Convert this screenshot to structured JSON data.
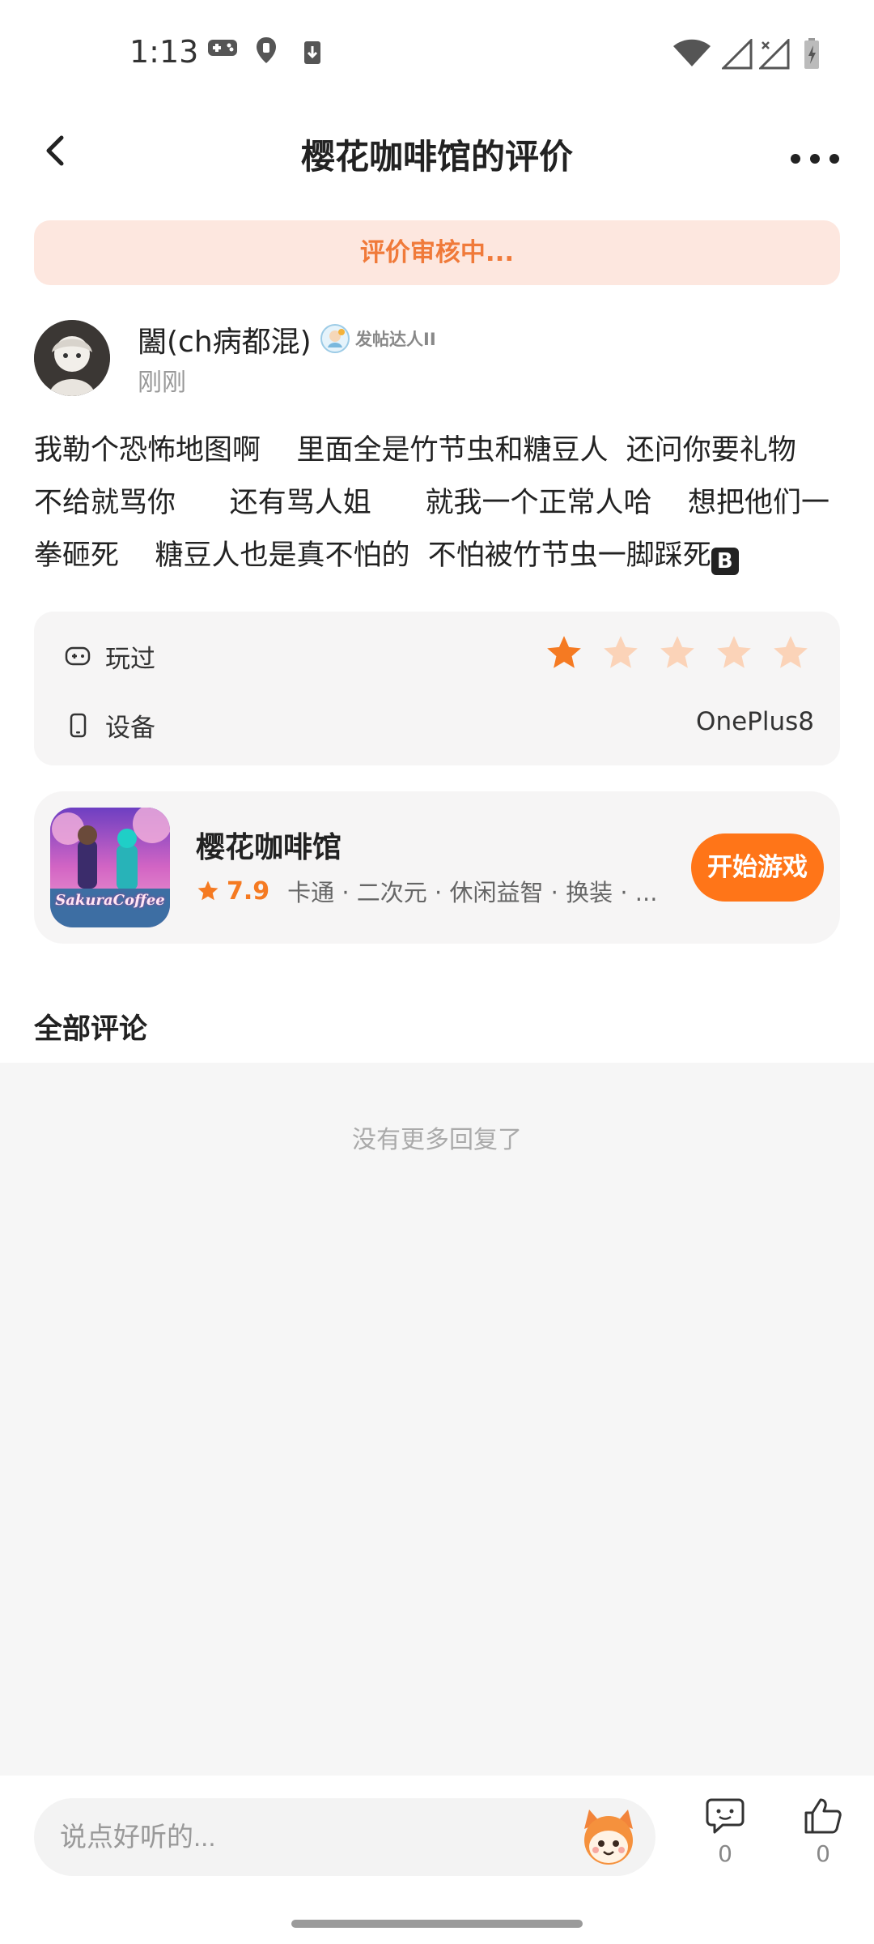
{
  "status_bar": {
    "time": "1:13"
  },
  "header": {
    "title": "樱花咖啡馆的评价"
  },
  "banner": {
    "text": "评价审核中..."
  },
  "review": {
    "author": "闔(ch病都混)",
    "badge": "发帖达人II",
    "time": "刚刚",
    "text_lines": [
      "我勒个恐怖地图啊    里面全是竹节虫和糖豆人  还问你要礼物",
      "不给就骂你      还有骂人姐      就我一个正常人哈    想把他们一",
      "拳砸死    糖豆人也是真不怕的  不怕被竹节虫一脚踩死"
    ],
    "emoji": "B",
    "played_label": "玩过",
    "rating": 1,
    "max_rating": 5,
    "device_label": "设备",
    "device": "OnePlus8"
  },
  "game": {
    "name": "樱花咖啡馆",
    "score": "7.9",
    "tags": "卡通 · 二次元 · 休闲益智 · 换装 · ...",
    "icon_caption": "SakuraCoffee",
    "button": "开始游戏"
  },
  "comments": {
    "title": "全部评论",
    "empty_text": "没有更多回复了"
  },
  "bottom_bar": {
    "placeholder": "说点好听的...",
    "comment_count": "0",
    "like_count": "0"
  },
  "colors": {
    "accent": "#ff7518",
    "star_filled": "#f57a22",
    "star_empty": "#fbd3b8",
    "banner_bg": "#fde7df",
    "banner_text": "#f07a3a"
  }
}
